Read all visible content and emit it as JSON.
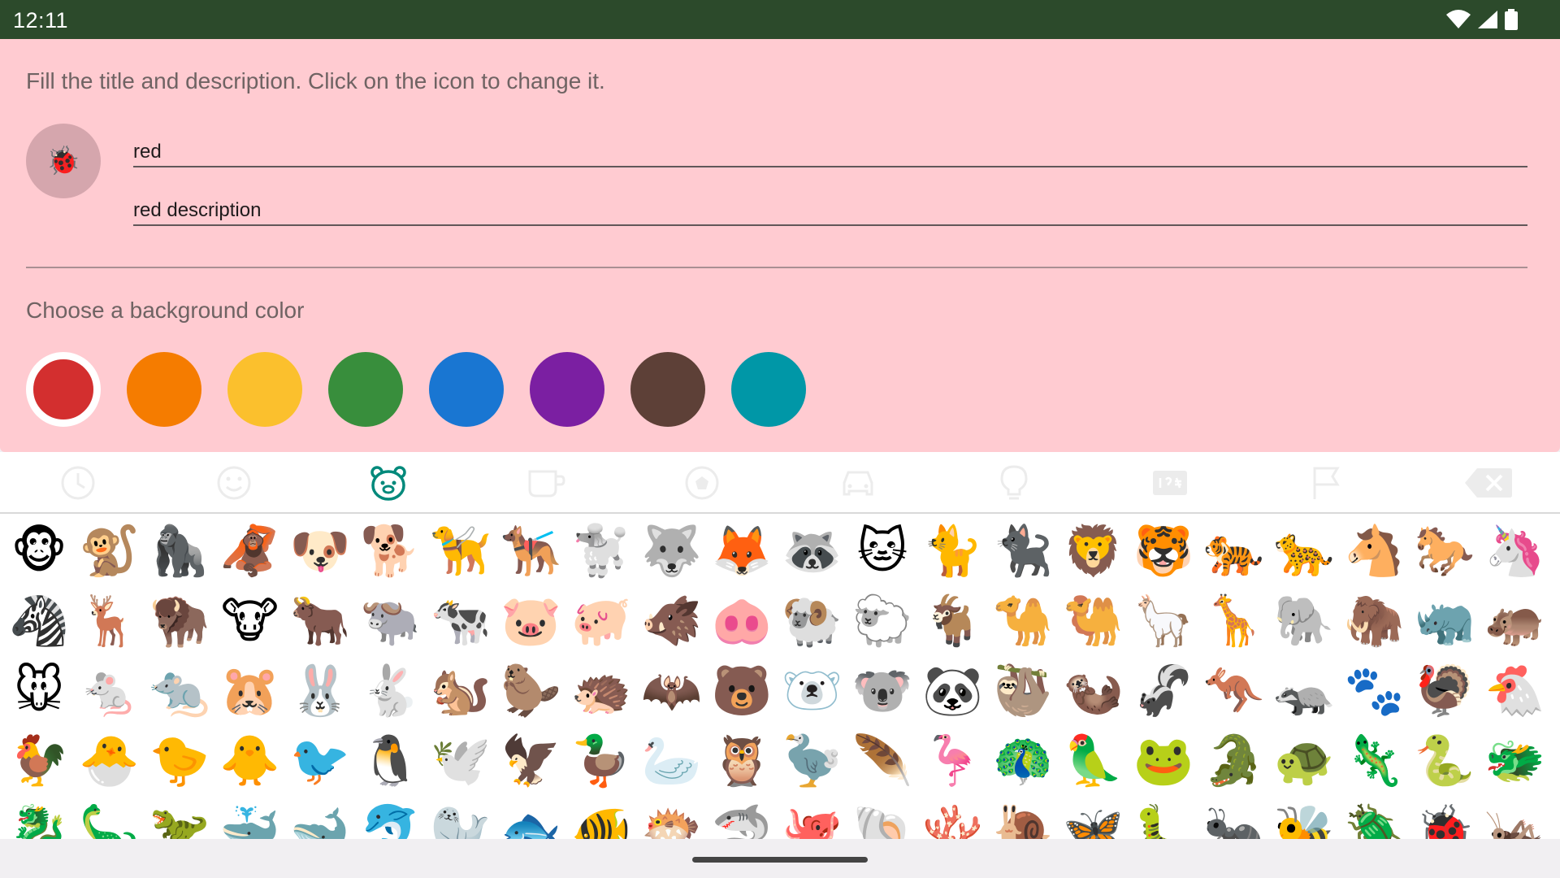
{
  "status_bar": {
    "time": "12:11",
    "icons": [
      "wifi-icon",
      "signal-icon",
      "battery-icon"
    ]
  },
  "form": {
    "instruction": "Fill the title and description. Click on the icon to change it.",
    "selected_icon": "🐞",
    "title_value": "red",
    "description_value": "red description",
    "colors_label": "Choose a background color",
    "background_color": "#ffcbd1",
    "colors": [
      {
        "name": "red",
        "hex": "#d32f2f",
        "selected": true
      },
      {
        "name": "orange",
        "hex": "#f57c00",
        "selected": false
      },
      {
        "name": "yellow",
        "hex": "#fbc02d",
        "selected": false
      },
      {
        "name": "green",
        "hex": "#388e3c",
        "selected": false
      },
      {
        "name": "blue",
        "hex": "#1976d2",
        "selected": false
      },
      {
        "name": "purple",
        "hex": "#7b1fa2",
        "selected": false
      },
      {
        "name": "brown",
        "hex": "#5d4037",
        "selected": false
      },
      {
        "name": "teal",
        "hex": "#0097a7",
        "selected": false
      }
    ]
  },
  "emoji_keyboard": {
    "tabs": [
      {
        "name": "recent",
        "icon": "clock-icon",
        "active": false
      },
      {
        "name": "smileys",
        "icon": "smiley-icon",
        "active": false
      },
      {
        "name": "animals",
        "icon": "bear-icon",
        "active": true
      },
      {
        "name": "food",
        "icon": "cup-icon",
        "active": false
      },
      {
        "name": "activities",
        "icon": "ball-icon",
        "active": false
      },
      {
        "name": "travel",
        "icon": "car-icon",
        "active": false
      },
      {
        "name": "objects",
        "icon": "bulb-icon",
        "active": false
      },
      {
        "name": "symbols",
        "icon": "symbols-icon",
        "active": false
      },
      {
        "name": "flags",
        "icon": "flag-icon",
        "active": false
      },
      {
        "name": "delete",
        "icon": "backspace-icon",
        "active": false
      }
    ],
    "active_color": "#00897b",
    "emoji_rows": [
      [
        "🐵",
        "🐒",
        "🦍",
        "🦧",
        "🐶",
        "🐕",
        "🦮",
        "🐕‍🦺",
        "🐩",
        "🐺",
        "🦊",
        "🦝",
        "🐱",
        "🐈",
        "🐈‍⬛",
        "🦁",
        "🐯",
        "🐅",
        "🐆",
        "🐴",
        "🐎",
        "🦄"
      ],
      [
        "🦓",
        "🦌",
        "🦬",
        "🐮",
        "🐂",
        "🐃",
        "🐄",
        "🐷",
        "🐖",
        "🐗",
        "🐽",
        "🐏",
        "🐑",
        "🐐",
        "🐪",
        "🐫",
        "🦙",
        "🦒",
        "🐘",
        "🦣",
        "🦏",
        "🦛"
      ],
      [
        "🐭",
        "🐁",
        "🐀",
        "🐹",
        "🐰",
        "🐇",
        "🐿️",
        "🦫",
        "🦔",
        "🦇",
        "🐻",
        "🐻‍❄️",
        "🐨",
        "🐼",
        "🦥",
        "🦦",
        "🦨",
        "🦘",
        "🦡",
        "🐾",
        "🦃",
        "🐔"
      ],
      [
        "🐓",
        "🐣",
        "🐤",
        "🐥",
        "🐦",
        "🐧",
        "🕊️",
        "🦅",
        "🦆",
        "🦢",
        "🦉",
        "🦤",
        "🪶",
        "🦩",
        "🦚",
        "🦜",
        "🐸",
        "🐊",
        "🐢",
        "🦎",
        "🐍",
        "🐲"
      ],
      [
        "🐉",
        "🦕",
        "🦖",
        "🐳",
        "🐋",
        "🐬",
        "🦭",
        "🐟",
        "🐠",
        "🐡",
        "🦈",
        "🐙",
        "🐚",
        "🪸",
        "🐌",
        "🦋",
        "🐛",
        "🐜",
        "🐝",
        "🪲",
        "🐞",
        "🦗"
      ]
    ]
  }
}
